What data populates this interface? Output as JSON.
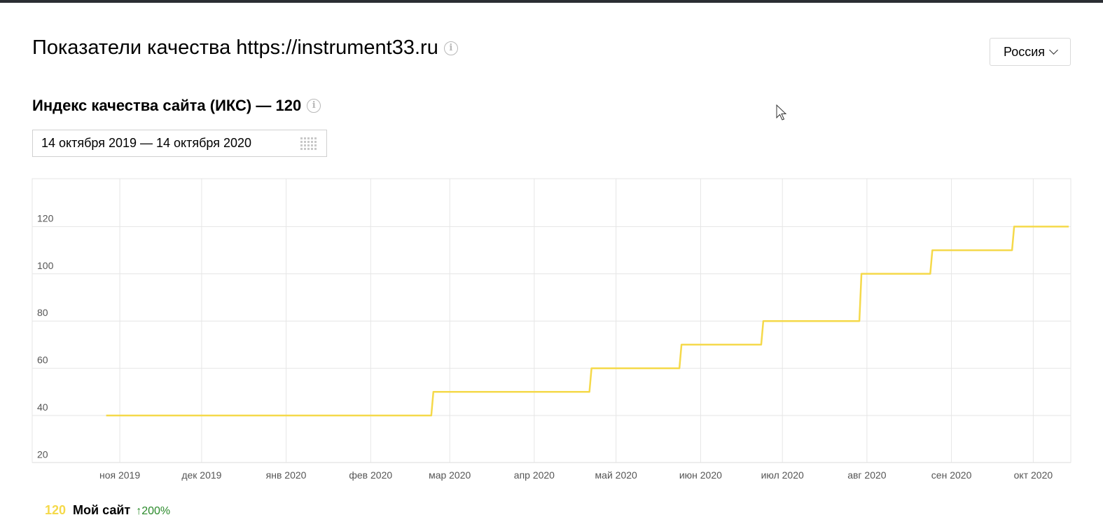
{
  "header": {
    "title": "Показатели качества https://instrument33.ru",
    "region_label": "Россия"
  },
  "iks": {
    "title": "Индекс качества сайта (ИКС) — 120",
    "date_range": "14 октября 2019 — 14 октября 2020"
  },
  "legend": {
    "value": "120",
    "name": "Мой сайт",
    "change": "↑200%"
  },
  "colors": {
    "line": "#f5d94a",
    "grid": "#e6e6e6",
    "tick_text": "#555555",
    "positive_change": "#2a8a2a",
    "top_bar": "#2b2e33"
  },
  "chart_data": {
    "type": "line",
    "x_start": "2019-10-14",
    "x_end": "2020-10-14",
    "x_ticks": [
      "ноя 2019",
      "дек 2019",
      "янв 2020",
      "фев 2020",
      "мар 2020",
      "апр 2020",
      "май 2020",
      "июн 2020",
      "июл 2020",
      "авг 2020",
      "сен 2020",
      "окт 2020"
    ],
    "y_ticks": [
      20,
      40,
      60,
      80,
      100,
      120
    ],
    "ylim": [
      20,
      120
    ],
    "grid": true,
    "step": true,
    "series": [
      {
        "name": "Мой сайт",
        "points": [
          [
            "2019-10-27",
            40
          ],
          [
            "2020-02-24",
            50
          ],
          [
            "2020-04-22",
            60
          ],
          [
            "2020-05-25",
            70
          ],
          [
            "2020-06-24",
            80
          ],
          [
            "2020-07-30",
            100
          ],
          [
            "2020-08-25",
            110
          ],
          [
            "2020-09-24",
            120
          ],
          [
            "2020-10-14",
            120
          ]
        ]
      }
    ]
  }
}
